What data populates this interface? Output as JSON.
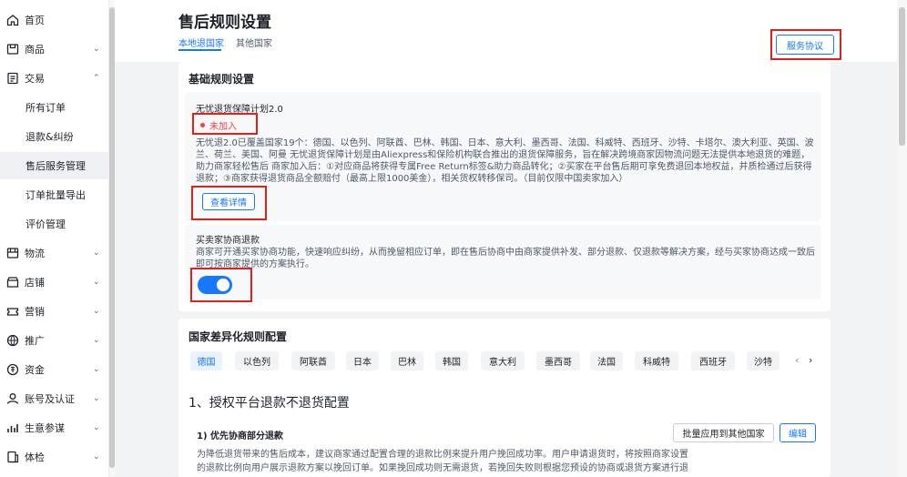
{
  "sidebar": {
    "items": [
      {
        "label": "首页",
        "icon": "home-icon",
        "chevron": ""
      },
      {
        "label": "商品",
        "icon": "product-icon",
        "chevron": "⌄"
      },
      {
        "label": "交易",
        "icon": "order-icon",
        "chevron": "⌃"
      },
      {
        "label": "物流",
        "icon": "truck-icon",
        "chevron": "⌄"
      },
      {
        "label": "店铺",
        "icon": "store-icon",
        "chevron": "⌄"
      },
      {
        "label": "营销",
        "icon": "ticket-icon",
        "chevron": "⌄"
      },
      {
        "label": "推广",
        "icon": "promote-icon",
        "chevron": "⌄"
      },
      {
        "label": "资金",
        "icon": "money-icon",
        "chevron": "⌄"
      },
      {
        "label": "账号及认证",
        "icon": "user-icon",
        "chevron": "⌄"
      },
      {
        "label": "生意参谋",
        "icon": "analytics-icon",
        "chevron": "⌄"
      },
      {
        "label": "体检",
        "icon": "checkup-icon",
        "chevron": "⌄"
      }
    ],
    "subitems": [
      "所有订单",
      "退款&纠纷",
      "售后服务管理",
      "订单批量导出",
      "评价管理"
    ]
  },
  "header": {
    "title": "售后规则设置",
    "tabs": [
      "本地退国家",
      "其他国家"
    ],
    "service_button": "服务协议"
  },
  "basic": {
    "title": "基础规则设置",
    "guarantee": {
      "title": "无忧退货保障计划2.0",
      "status": "未加入",
      "description": "无忧退2.0已覆盖国家19个：德国、以色列、阿联酋、巴林、韩国、日本、意大利、墨西哥、法国、科威特、西班牙、沙特、卡塔尔、澳大利亚、英国、波兰、荷兰、美国、阿曼 无忧退货保障计划是由Aliexpress和保险机构联合推出的退货保障服务，旨在解决跨境商家因物流问题无法提供本地退货的难题，助力商家轻松售后 商家加入后：①对应商品将获得专属Free Return标签&助力商品转化；②买家在平台售后期可享免费退回本地权益，并质检通过后获得退款；③商家获得退货商品全额赔付（最高上限1000美金），相关货权转移保司。（目前仅限中国卖家加入）",
      "detail_button": "查看详情"
    },
    "negotiate": {
      "title": "买卖家协商退款",
      "description": "商家可开通买家协商功能，快速响应纠纷，从而挽留相应订单，即在售后协商中由商家提供补发、部分退款、仅退款等解决方案，经与买家协商达成一致后即可按商家提供的方案执行。",
      "enabled": true
    }
  },
  "country": {
    "title": "国家差异化规则配置",
    "tabs": [
      "德国",
      "以色列",
      "阿联酋",
      "日本",
      "巴林",
      "韩国",
      "意大利",
      "墨西哥",
      "法国",
      "科威特",
      "西班牙",
      "沙特"
    ],
    "prev": "‹",
    "next": "›",
    "section_heading": "1、授权平台退款不退货配置",
    "sub": {
      "title": "1) 优先协商部分退款",
      "batch_button": "批量应用到其他国家",
      "edit_button": "编辑",
      "desc_line1": "为降低退货带来的售后成本，建议商家通过配置合理的退款比例来提升用户挽回成功率。用户申请退货时，将按照商家设置",
      "desc_line2": "的退款比例向用户展示退款方案以挽回订单。如果挽回成功则无需退货，若挽回失败则根据您预设的协商或退货方案进行退"
    }
  },
  "colors": {
    "accent": "#1677ff",
    "highlight": "#e0201b",
    "danger": "#f53f3f"
  }
}
